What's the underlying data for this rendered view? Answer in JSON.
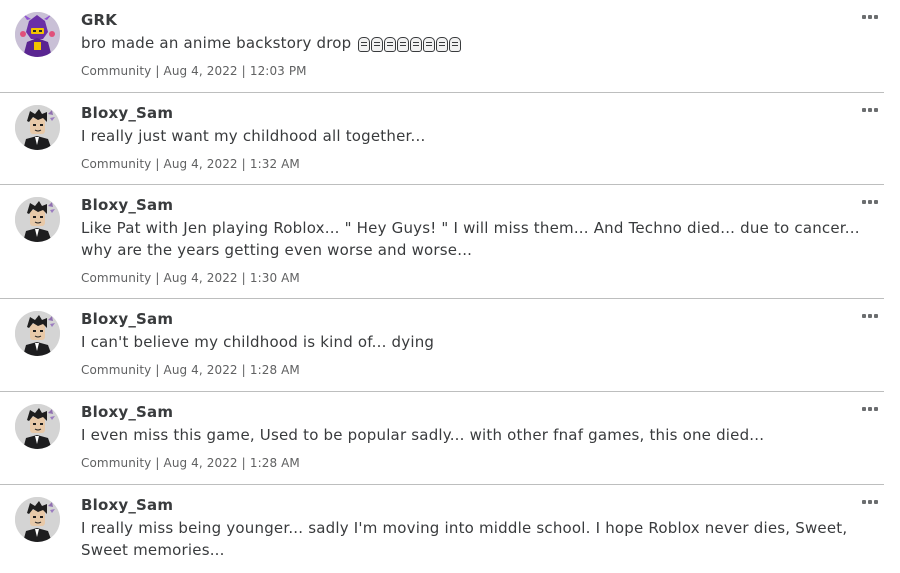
{
  "posts": [
    {
      "author": "GRK",
      "body": "bro made an anime backstory drop",
      "emoji_icon": "skull-emoji-icon",
      "emoji_count": 8,
      "category": "Community",
      "date": "Aug 4, 2022",
      "time": "12:03 PM",
      "avatar": "purple-armored-avatar"
    },
    {
      "author": "Bloxy_Sam",
      "body": "I really just want my childhood all together...",
      "category": "Community",
      "date": "Aug 4, 2022",
      "time": "1:32 AM",
      "avatar": "suit-avatar"
    },
    {
      "author": "Bloxy_Sam",
      "body": "Like Pat with Jen playing Roblox... \" Hey Guys! \" I will miss them... And Techno died... due to cancer... why are the years getting even worse and worse...",
      "category": "Community",
      "date": "Aug 4, 2022",
      "time": "1:30 AM",
      "avatar": "suit-avatar"
    },
    {
      "author": "Bloxy_Sam",
      "body": "I can't believe my childhood is kind of... dying",
      "category": "Community",
      "date": "Aug 4, 2022",
      "time": "1:28 AM",
      "avatar": "suit-avatar"
    },
    {
      "author": "Bloxy_Sam",
      "body": "I even miss this game, Used to be popular sadly... with other fnaf games, this one died...",
      "category": "Community",
      "date": "Aug 4, 2022",
      "time": "1:28 AM",
      "avatar": "suit-avatar"
    },
    {
      "author": "Bloxy_Sam",
      "body": "I really miss being younger... sadly I'm moving into middle school. I hope Roblox never dies, Sweet, Sweet memories...",
      "category": "Community",
      "date": "",
      "time": "",
      "avatar": "suit-avatar"
    }
  ],
  "separator": "|",
  "colors": {
    "text": "#393b3d",
    "meta": "#606162",
    "divider": "#bdbebe",
    "avatar_bg": "#d4d4d4",
    "grk_purple": "#7b3fb8"
  }
}
